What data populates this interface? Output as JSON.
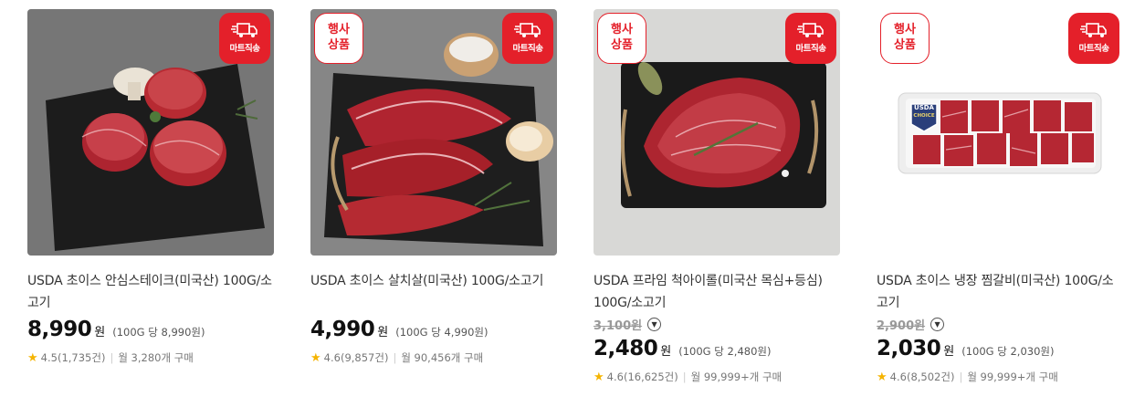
{
  "badges": {
    "event": [
      "행사",
      "상품"
    ],
    "mart": "마트직송"
  },
  "products": [
    {
      "name": "USDA 초이스 안심스테이크(미국산) 100G/소고기",
      "orig_price": "",
      "price": "8,990",
      "won": "원",
      "unit_price": "(100G 당 8,990원)",
      "rating": "4.5",
      "reviews": "(1,735건)",
      "monthly": "월 3,280개 구매",
      "event": false
    },
    {
      "name": "USDA 초이스 살치살(미국산) 100G/소고기",
      "orig_price": "",
      "price": "4,990",
      "won": "원",
      "unit_price": "(100G 당 4,990원)",
      "rating": "4.6",
      "reviews": "(9,857건)",
      "monthly": "월 90,456개 구매",
      "event": true
    },
    {
      "name": "USDA 프라임 척아이롤(미국산 목심+등심) 100G/소고기",
      "orig_price": "3,100원",
      "price": "2,480",
      "won": "원",
      "unit_price": "(100G 당 2,480원)",
      "rating": "4.6",
      "reviews": "(16,625건)",
      "monthly": "월 99,999+개 구매",
      "event": true
    },
    {
      "name": "USDA 초이스 냉장 찜갈비(미국산) 100G/소고기",
      "orig_price": "2,900원",
      "price": "2,030",
      "won": "원",
      "unit_price": "(100G 당 2,030원)",
      "rating": "4.6",
      "reviews": "(8,502건)",
      "monthly": "월 99,999+개 구매",
      "event": true
    }
  ],
  "package_label": [
    "USDA",
    "CHOICE"
  ],
  "colors": {
    "brand_red": "#e4202a",
    "star": "#f5b400",
    "meat": "#b3262e",
    "slate": "#1f1f1f"
  }
}
